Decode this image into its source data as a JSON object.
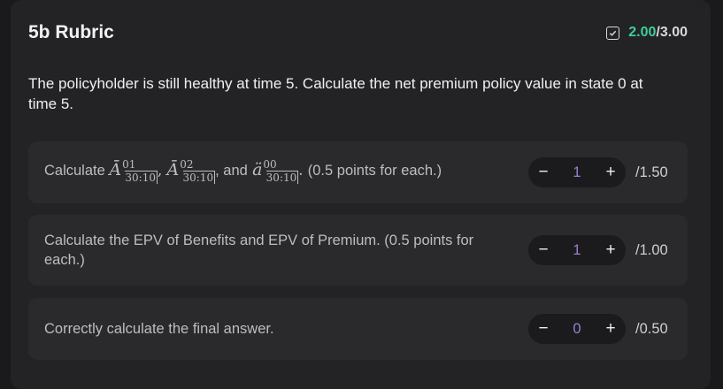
{
  "header": {
    "title": "5b Rubric",
    "score_earned": "2.00",
    "score_total": "/3.00"
  },
  "prompt": "The policyholder is still healthy at time 5. Calculate the net premium policy value in state 0 at time 5.",
  "items": [
    {
      "text_prefix": "Calculate",
      "math": [
        {
          "symbol": "Ā",
          "sup": "01",
          "sub": "30:10",
          "sep": ","
        },
        {
          "symbol": "Ā",
          "sup": "02",
          "sub": "30:10",
          "sep": ", and"
        },
        {
          "symbol": "ä",
          "sup": "00",
          "sub": "30:10",
          "sep": "."
        }
      ],
      "text_suffix": "(0.5 points for each.)",
      "value": "1",
      "max": "/1.50"
    },
    {
      "text": "Calculate the EPV of Benefits and EPV of Premium. (0.5 points for each.)",
      "value": "1",
      "max": "/1.00"
    },
    {
      "text": "Correctly calculate the final answer.",
      "value": "0",
      "max": "/0.50"
    }
  ],
  "stepper": {
    "minus": "−",
    "plus": "+"
  },
  "icons": {
    "check": "checkbox-check-icon"
  },
  "colors": {
    "earned": "#3ecf9a",
    "value": "#9b7fd1"
  }
}
